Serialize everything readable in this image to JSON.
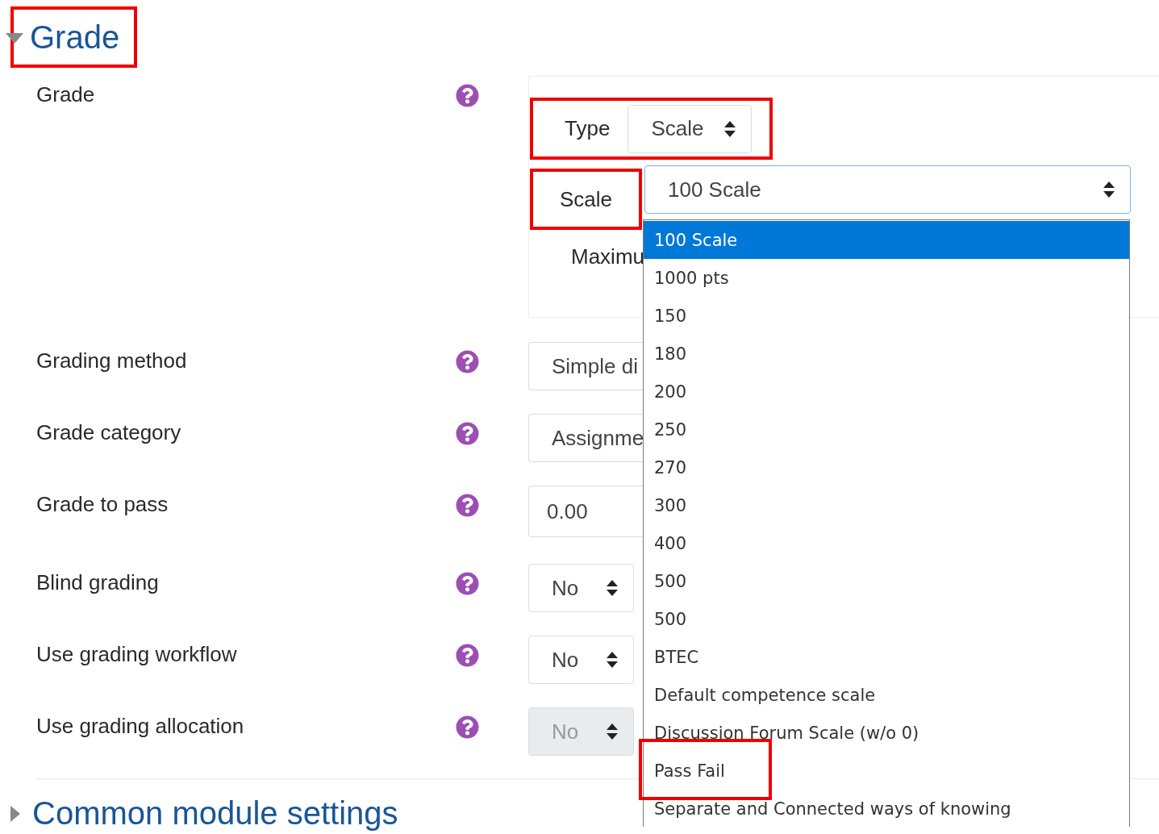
{
  "section": {
    "title": "Grade",
    "expanded": true,
    "highlighted": true
  },
  "grade": {
    "label": "Grade",
    "type_label": "Type",
    "type_value": "Scale",
    "type_highlighted": true,
    "scale_label": "Scale",
    "scale_highlighted": true,
    "scale_value": "100 Scale",
    "max_label": "Maximu"
  },
  "dropdown": {
    "expanded": true,
    "options": [
      {
        "label": "100 Scale",
        "selected": true,
        "highlighted": false
      },
      {
        "label": "1000 pts",
        "selected": false,
        "highlighted": false
      },
      {
        "label": "150",
        "selected": false,
        "highlighted": false
      },
      {
        "label": "180",
        "selected": false,
        "highlighted": false
      },
      {
        "label": "200",
        "selected": false,
        "highlighted": false
      },
      {
        "label": "250",
        "selected": false,
        "highlighted": false
      },
      {
        "label": "270",
        "selected": false,
        "highlighted": false
      },
      {
        "label": "300",
        "selected": false,
        "highlighted": false
      },
      {
        "label": "400",
        "selected": false,
        "highlighted": false
      },
      {
        "label": "500",
        "selected": false,
        "highlighted": false
      },
      {
        "label": "500",
        "selected": false,
        "highlighted": false
      },
      {
        "label": "BTEC",
        "selected": false,
        "highlighted": false
      },
      {
        "label": "Default competence scale",
        "selected": false,
        "highlighted": false
      },
      {
        "label": "Discussion Forum Scale (w/o 0)",
        "selected": false,
        "highlighted": false
      },
      {
        "label": "Pass Fail",
        "selected": false,
        "highlighted": true
      },
      {
        "label": "Separate and Connected ways of knowing",
        "selected": false,
        "highlighted": false
      }
    ]
  },
  "fields": [
    {
      "label": "Grading method",
      "kind": "select",
      "value": "Simple di",
      "disabled": false
    },
    {
      "label": "Grade category",
      "kind": "select",
      "value": "Assignme",
      "disabled": false
    },
    {
      "label": "Grade to pass",
      "kind": "input",
      "value": "0.00",
      "disabled": false
    },
    {
      "label": "Blind grading",
      "kind": "select",
      "value": "No",
      "disabled": false
    },
    {
      "label": "Use grading workflow",
      "kind": "select",
      "value": "No",
      "disabled": false
    },
    {
      "label": "Use grading allocation",
      "kind": "select",
      "value": "No",
      "disabled": true
    }
  ],
  "next_section": {
    "title": "Common module settings",
    "expanded": false
  }
}
